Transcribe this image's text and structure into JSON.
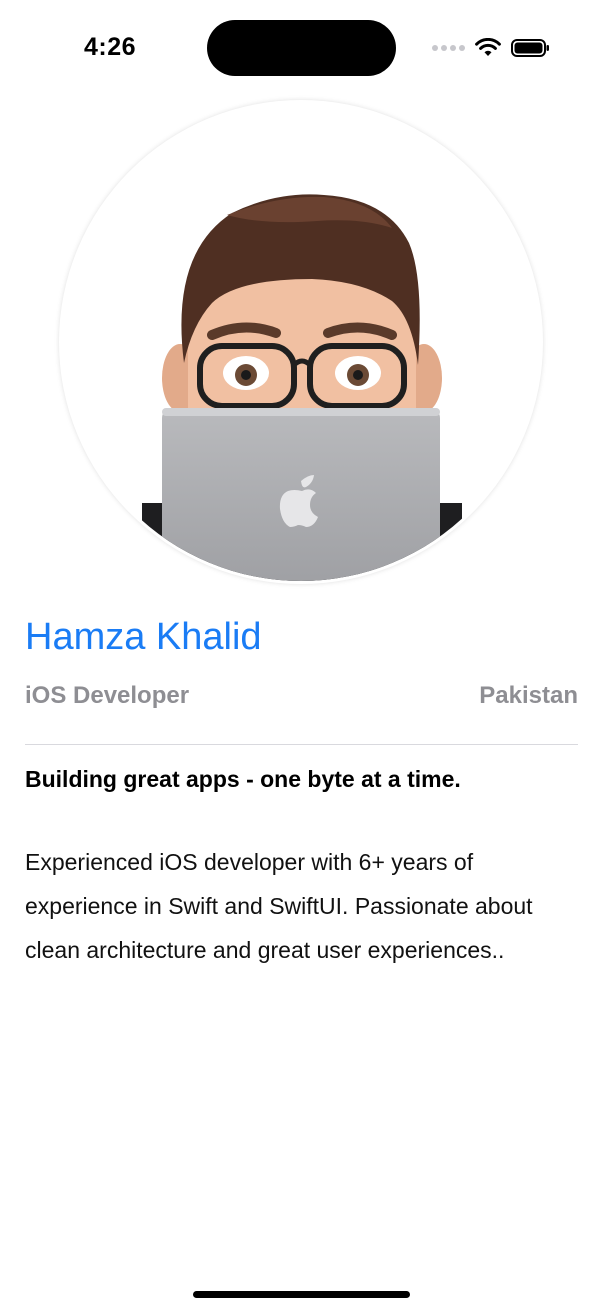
{
  "status_bar": {
    "time": "4:26",
    "icons": [
      "cellular-dots-icon",
      "wifi-icon",
      "battery-icon"
    ]
  },
  "profile": {
    "avatar_icon": "memoji-laptop-avatar",
    "name": "Hamza Khalid",
    "role": "iOS Developer",
    "country": "Pakistan",
    "tagline": "Building great apps - one byte at a time.",
    "bio": "Experienced iOS developer with 6+ years of experience in Swift and SwiftUI. Passionate about clean architecture and great user experiences.."
  },
  "colors": {
    "accent": "#1a7cf5",
    "secondary_text": "#8e8e93",
    "background": "#ffffff"
  }
}
